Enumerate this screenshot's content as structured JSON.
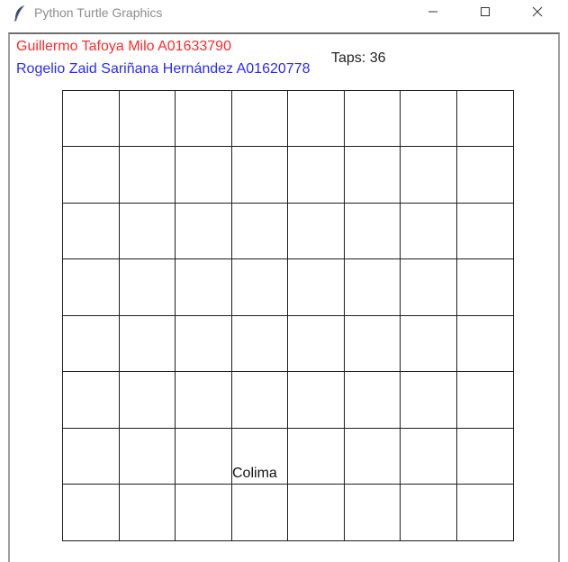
{
  "window": {
    "title": "Python Turtle Graphics",
    "icon": "feather-icon",
    "controls": [
      "minimize-icon",
      "maximize-icon",
      "close-icon"
    ]
  },
  "authors": [
    {
      "text": "Guillermo Tafoya Milo A01633790",
      "color": "#ff2a2a"
    },
    {
      "text": "Rogelio Zaid Sariñana Hernández A01620778",
      "color": "#2a2aff"
    }
  ],
  "taps_text": "Taps: 36",
  "board": {
    "rows": 8,
    "cols": 8,
    "revealed_label": "Colima",
    "line_color": "#1e1e1e"
  }
}
